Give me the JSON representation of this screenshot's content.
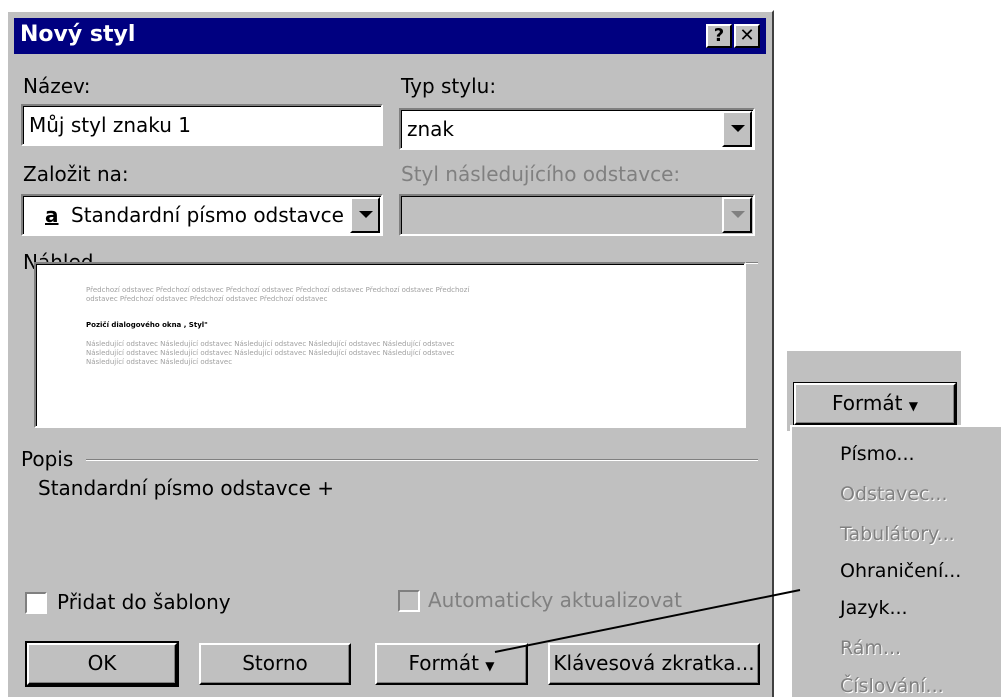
{
  "dialog": {
    "title": "Nový styl",
    "help_label": "?",
    "close_label": "✕",
    "name_label": "Název:",
    "name_value": "Můj styl znaku 1",
    "style_type_label": "Typ stylu:",
    "style_type_value": "znak",
    "based_on_label": "Založit na:",
    "based_on_icon": "a",
    "based_on_value": "Standardní písmo odstavce",
    "next_style_label": "Styl následujícího odstavce:",
    "preview_label": "Náhled",
    "preview": {
      "prev_line1": "Předchozí odstavec Předchozí odstavec Předchozí odstavec Předchozí odstavec Předchozí odstavec Předchozí",
      "prev_line2": "odstavec Předchozí odstavec Předchozí odstavec Předchozí odstavec",
      "sample": "Pozičí dialogového okna , Styl\"",
      "next_line1": "Následující odstavec Následující odstavec Následující odstavec Následující odstavec Následující odstavec",
      "next_line2": "Následující odstavec Následující odstavec Následující odstavec Následující odstavec Následující odstavec",
      "next_line3": "Následující odstavec Následující odstavec"
    },
    "description_label": "Popis",
    "description_value": "Standardní písmo odstavce +",
    "add_to_template_label": "Přidat do šablony",
    "auto_update_label": "Automaticky aktualizovat",
    "ok_label": "OK",
    "cancel_label": "Storno",
    "format_label": "Formát",
    "shortcut_label": "Klávesová zkratka..."
  },
  "format_menu": {
    "button_label": "Formát",
    "items": [
      {
        "label": "Písmo...",
        "enabled": true
      },
      {
        "label": "Odstavec...",
        "enabled": false
      },
      {
        "label": "Tabulátory...",
        "enabled": false
      },
      {
        "label": "Ohraničení...",
        "enabled": true
      },
      {
        "label": "Jazyk...",
        "enabled": true
      },
      {
        "label": "Rám...",
        "enabled": false
      },
      {
        "label": "Číslování...",
        "enabled": false
      }
    ]
  },
  "colors": {
    "titlebar": "#000080",
    "face": "#c0c0c0",
    "disabled_text": "#808080"
  }
}
